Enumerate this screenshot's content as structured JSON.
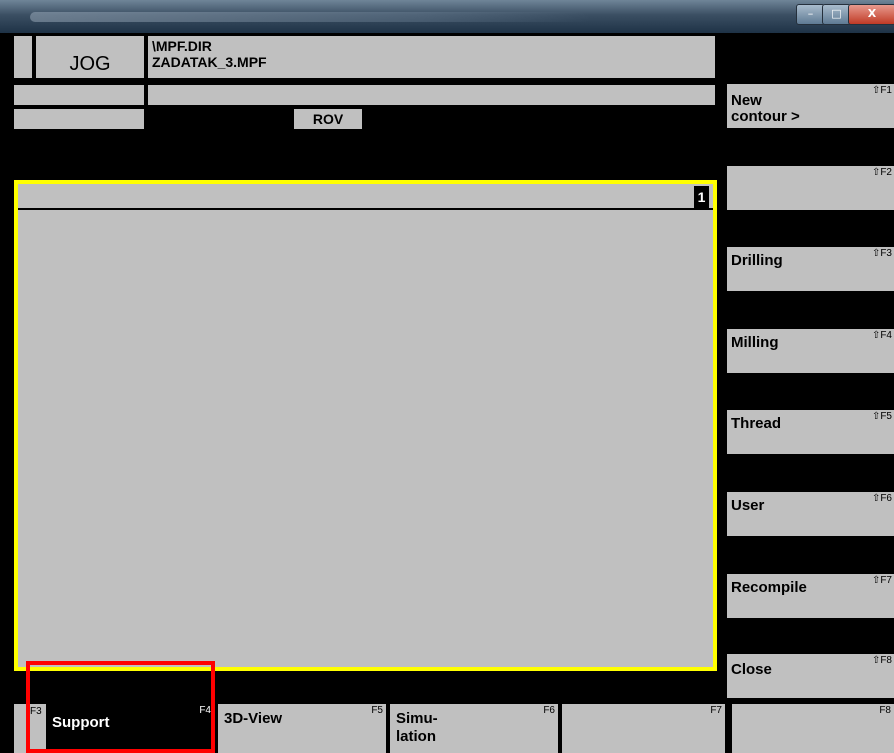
{
  "window": {
    "minimize_label": "–",
    "maximize_label": "□",
    "close_label": "X"
  },
  "header": {
    "mode": "JOG",
    "path": "\\MPF.DIR",
    "program": "ZADATAK_3.MPF",
    "rov": "ROV"
  },
  "editor": {
    "line_number": "1"
  },
  "softkeys_right": [
    {
      "label": "New contour >",
      "line1": "New",
      "line2": "contour >",
      "fkey": "⇧F1"
    },
    {
      "label": "",
      "fkey": "⇧F2"
    },
    {
      "label": "Drilling",
      "fkey": "⇧F3"
    },
    {
      "label": "Milling",
      "fkey": "⇧F4"
    },
    {
      "label": "Thread",
      "fkey": "⇧F5"
    },
    {
      "label": "User",
      "fkey": "⇧F6"
    },
    {
      "label": "Recompile",
      "fkey": "⇧F7"
    },
    {
      "label": "Close",
      "fkey": "⇧F8"
    }
  ],
  "softkeys_bottom": [
    {
      "label": "Support",
      "fkey": "F4",
      "selected": true
    },
    {
      "label": "3D-View",
      "fkey": "F5"
    },
    {
      "label": "Simu-lation",
      "line1": "Simu-",
      "line2": "lation",
      "fkey": "F6"
    },
    {
      "label": "",
      "fkey": "F7"
    },
    {
      "label": "",
      "fkey": "F8"
    }
  ],
  "f3_tab": "F3",
  "colors": {
    "panel_gray": "#c0c0c0",
    "frame_yellow": "#ffff00",
    "highlight_red": "#ff0000",
    "background": "#000000"
  }
}
